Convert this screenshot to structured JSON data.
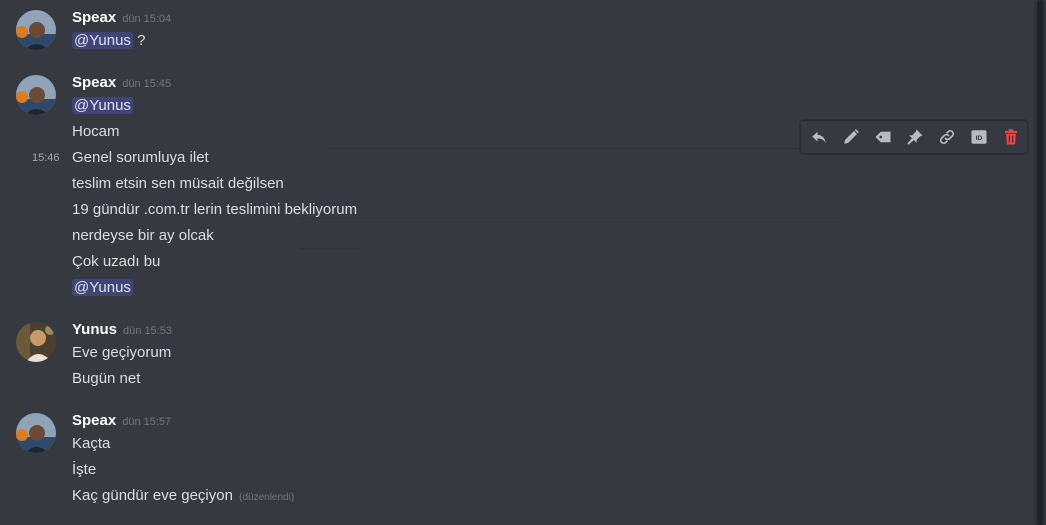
{
  "colors": {
    "background": "#36393f",
    "mention_bg": "#474d7a",
    "mention_text": "#dee0fc",
    "delete": "#ed4245",
    "icon": "#b9bbbe"
  },
  "messages": [
    {
      "author": "Speax",
      "time": "dün 15:04",
      "mention": "@Yunus",
      "mention_suffix": " ?"
    },
    {
      "author": "Speax",
      "time": "dün 15:45",
      "mention": "@Yunus",
      "lines": [
        "Hocam"
      ],
      "hover_time": "15:46",
      "more_lines": [
        "Genel sorumluya ilet",
        "teslim etsin sen müsait değilsen",
        "19 gündür .com.tr lerin teslimini bekliyorum",
        "nerdeyse bir ay olcak",
        "Çok uzadı bu"
      ],
      "end_mention": "@Yunus"
    },
    {
      "author": "Yunus",
      "time": "dün 15:53",
      "lines": [
        "Eve geçiyorum",
        "Bugün net"
      ]
    },
    {
      "author": "Speax",
      "time": "dün 15:57",
      "lines": [
        "Kaçta",
        "İşte",
        "Kaç gündür eve geçiyon"
      ],
      "edited": "(düzenlendi)"
    }
  ],
  "toolbar": {
    "icons": [
      "reply-icon",
      "edit-icon",
      "tag-icon",
      "pin-icon",
      "link-icon",
      "id-icon",
      "delete-icon"
    ],
    "id_label": "ID"
  }
}
